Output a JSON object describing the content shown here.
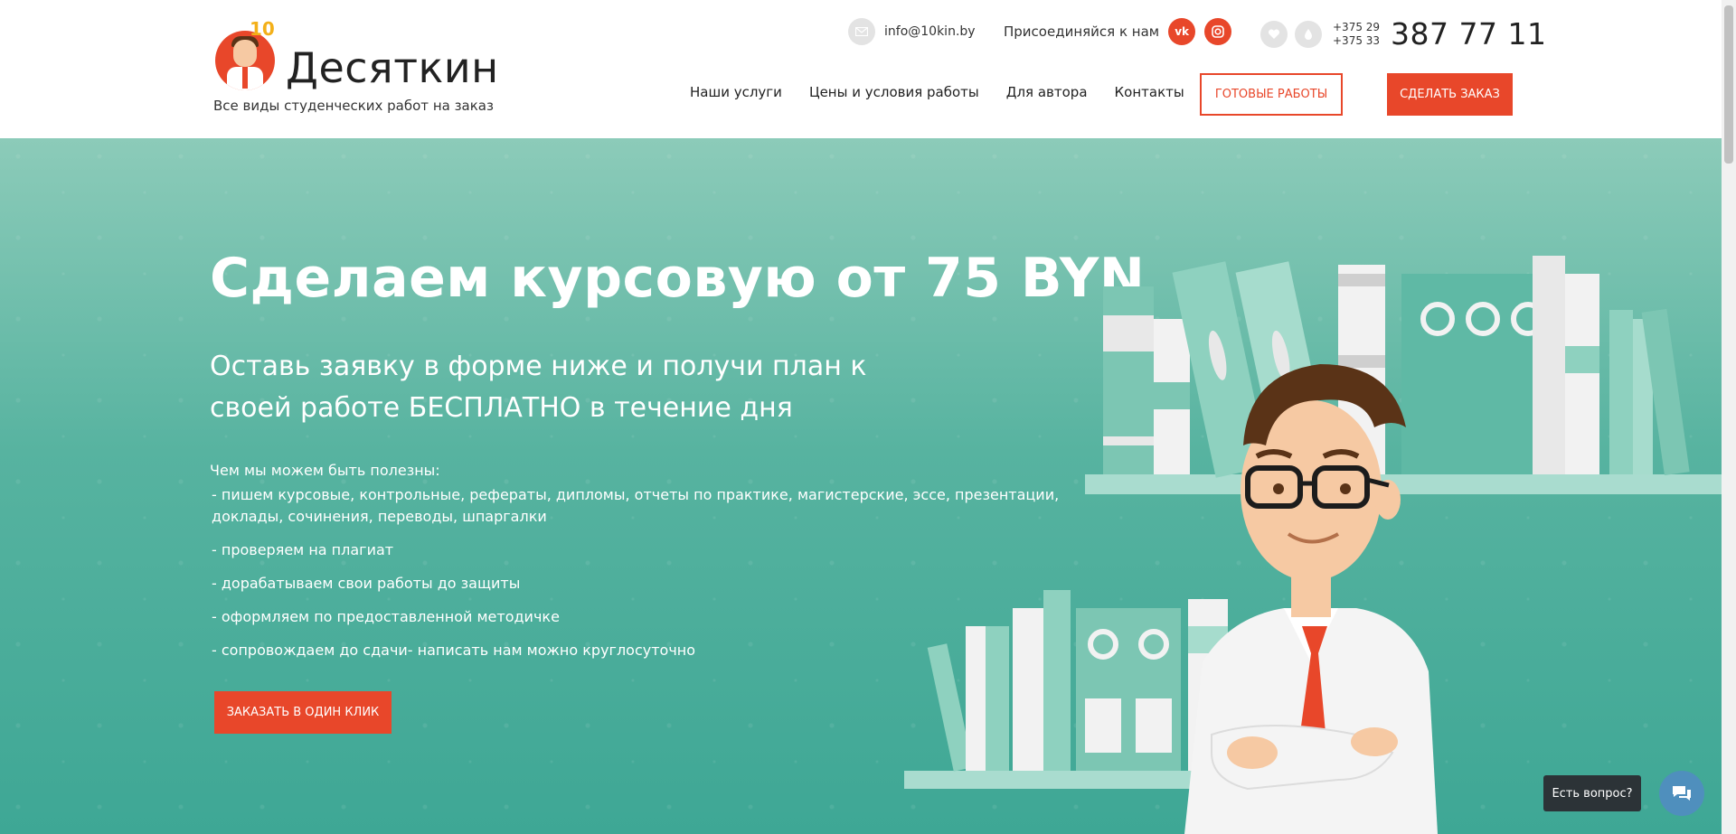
{
  "brand": {
    "name": "Десяткин",
    "badge_number": "10",
    "tagline": "Все виды студенческих работ на заказ"
  },
  "contact": {
    "email": "info@10kin.by",
    "join_label": "Присоединяйся к нам",
    "phone_code_1": "+375 29",
    "phone_code_2": "+375 33",
    "phone_number": "387 77 11"
  },
  "nav": {
    "items": [
      "Наши услуги",
      "Цены и условия работы",
      "Для автора",
      "Контакты"
    ]
  },
  "buttons": {
    "ready_works": "ГОТОВЫЕ РАБОТЫ",
    "make_order": "СДЕЛАТЬ ЗАКАЗ",
    "one_click": "ЗАКАЗАТЬ В ОДИН КЛИК"
  },
  "hero": {
    "title": "Сделаем курсовую от 75 BYN",
    "subtitle": "Оставь заявку в форме ниже и получи план к своей работе БЕСПЛАТНО в течение дня",
    "intro": "Чем мы можем быть полезны:",
    "items": [
      "- пишем курсовые, контрольные, рефераты, дипломы, отчеты по практике, магистерские, эссе, презентации, доклады, сочинения, переводы, шпаргалки",
      "- проверяем на плагиат",
      "- дорабатываем свои работы до защиты",
      "- оформляем по предоставленной методичке",
      "- сопровождаем до сдачи- написать нам можно круглосуточно"
    ]
  },
  "chat": {
    "label": "Есть вопрос?"
  },
  "colors": {
    "accent": "#e8472a",
    "hero_top": "#8ccbb9",
    "hero_bottom": "#3ea795",
    "chat_button": "#4f8fbd"
  },
  "icons": {
    "email": "envelope-icon",
    "vk": "vk-icon",
    "instagram": "instagram-icon",
    "viber": "viber-icon",
    "velcom": "drop-icon",
    "chat": "chat-bubbles-icon"
  }
}
